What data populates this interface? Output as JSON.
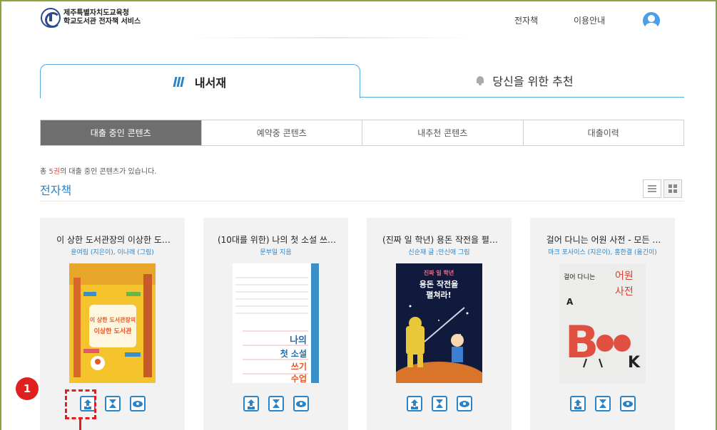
{
  "header": {
    "org_line1": "제주특별자치도교육청",
    "org_line2": "학교도서관 전자책 서비스",
    "nav_ebook": "전자책",
    "nav_guide": "이용안내"
  },
  "main_tabs": [
    {
      "label": "내서재",
      "active": true
    },
    {
      "label": "당신을 위한 추천",
      "active": false
    }
  ],
  "sub_tabs": [
    {
      "label": "대출 중인 콘텐츠",
      "active": true
    },
    {
      "label": "예약중 콘텐츠",
      "active": false
    },
    {
      "label": "내추천 콘텐츠",
      "active": false
    },
    {
      "label": "대출이력",
      "active": false
    }
  ],
  "summary": {
    "prefix": "총 ",
    "count": "5권",
    "suffix": "의 대출 중인 콘텐츠가 있습니다."
  },
  "section_title": "전자책",
  "books": [
    {
      "title": "이 상한 도서관장의 이상한 도…",
      "author": "윤여림 (지은이), 이나래 (그림)",
      "cover_texts": [
        "이 상한 도서관장의",
        "이상한 도서관"
      ]
    },
    {
      "title": "(10대를 위한) 나의 첫 소설 쓰…",
      "author": "문부일 지음",
      "cover_texts": [
        "나의",
        "첫 소설",
        "쓰기",
        "수업"
      ]
    },
    {
      "title": "(진짜 일 학년) 용돈 작전을 펼…",
      "author": "신순재 글 ;안신애 그림",
      "cover_texts": [
        "진짜 일 학년",
        "용돈 작전을",
        "펼쳐라!"
      ]
    },
    {
      "title": "걸어 다니는 어원 사전 - 모든 …",
      "author": "마크 포사이스 (지은이), 홍한결 (옮긴이)",
      "cover_texts": [
        "걸어 다니는",
        "어원",
        "사전",
        "A",
        "B",
        "K"
      ]
    }
  ],
  "annotation": {
    "step": "1"
  },
  "colors": {
    "accent": "#2b84c7",
    "highlight": "#e01f1f",
    "active_tab": "#6e6e6e"
  }
}
